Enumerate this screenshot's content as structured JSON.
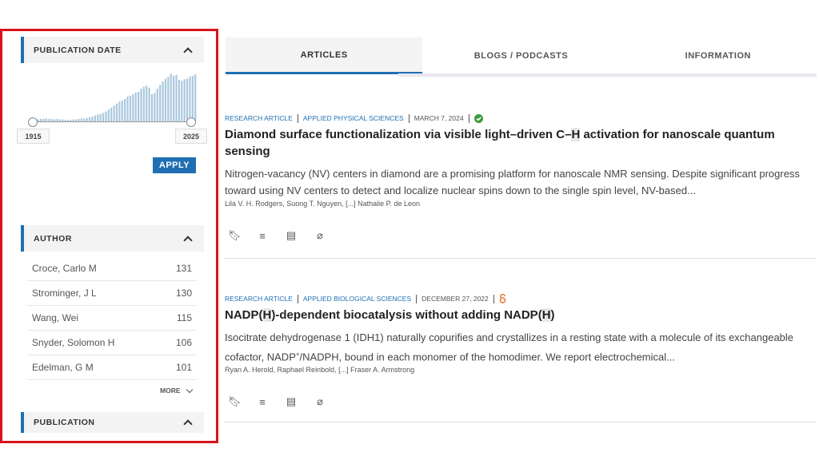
{
  "filters": {
    "publication_date": {
      "label": "PUBLICATION DATE",
      "range_start": "1915",
      "range_end": "2025",
      "apply_label": "APPLY",
      "histogram": [
        0.02,
        0.04,
        0.05,
        0.04,
        0.05,
        0.05,
        0.06,
        0.05,
        0.05,
        0.04,
        0.05,
        0.04,
        0.04,
        0.03,
        0.03,
        0.03,
        0.04,
        0.04,
        0.05,
        0.06,
        0.06,
        0.07,
        0.08,
        0.1,
        0.12,
        0.14,
        0.15,
        0.17,
        0.2,
        0.24,
        0.28,
        0.32,
        0.36,
        0.4,
        0.42,
        0.45,
        0.5,
        0.52,
        0.55,
        0.58,
        0.6,
        0.66,
        0.7,
        0.72,
        0.68,
        0.55,
        0.58,
        0.66,
        0.74,
        0.8,
        0.86,
        0.9,
        0.96,
        0.92,
        0.94,
        0.84,
        0.82,
        0.85,
        0.86,
        0.9,
        0.92,
        0.95
      ]
    },
    "author": {
      "label": "AUTHOR",
      "items": [
        {
          "name": "Croce, Carlo M",
          "count": "131"
        },
        {
          "name": "Strominger, J L",
          "count": "130"
        },
        {
          "name": "Wang, Wei",
          "count": "115"
        },
        {
          "name": "Snyder, Solomon H",
          "count": "106"
        },
        {
          "name": "Edelman, G M",
          "count": "101"
        }
      ],
      "more_label": "MORE"
    },
    "publication": {
      "label": "PUBLICATION"
    }
  },
  "tabs": [
    {
      "label": "ARTICLES",
      "active": true
    },
    {
      "label": "BLOGS / PODCASTS"
    },
    {
      "label": "INFORMATION"
    }
  ],
  "articles": [
    {
      "type": "RESEARCH ARTICLE",
      "section": "APPLIED PHYSICAL SCIENCES",
      "date": "MARCH 7, 2024",
      "badge": "check-circle-icon",
      "badge_color": "#3c9a3c",
      "title_pre": "Diamond surface functionalization via visible light–driven C–",
      "title_hl": "H",
      "title_post": " activation for nanoscale quantum sensing",
      "abstract": "Nitrogen-vacancy (NV) centers in diamond are a promising platform for nanoscale NMR sensing. Despite significant progress toward using NV centers to detect and localize nuclear spins down to the single spin level, NV-based...",
      "authors": "Lila V. H. Rodgers, Suong T. Nguyen, [...] Nathalie P. de Leon"
    },
    {
      "type": "RESEARCH ARTICLE",
      "section": "APPLIED BIOLOGICAL SCIENCES",
      "date": "DECEMBER 27, 2022",
      "badge": "open-access-icon",
      "badge_color": "#e8762b",
      "title_a": "NADP(",
      "title_hl1": "H",
      "title_b": ")-dependent biocatalysis without adding NADP(",
      "title_hl2": "H",
      "title_c": ")",
      "abstract_a": "Isocitrate dehydrogenase 1 (IDH1) naturally copurifies and crystallizes in a resting state with a molecule of its exchangeable cofactor, NADP",
      "abstract_sup": "+",
      "abstract_b": "/NADPH, bound in each monomer of the homodimer. We report electrochemical...",
      "authors": "Ryan A. Herold, Raphael Reinbold, [...] Fraser A. Armstrong"
    }
  ],
  "accent": "#1f6fb2"
}
